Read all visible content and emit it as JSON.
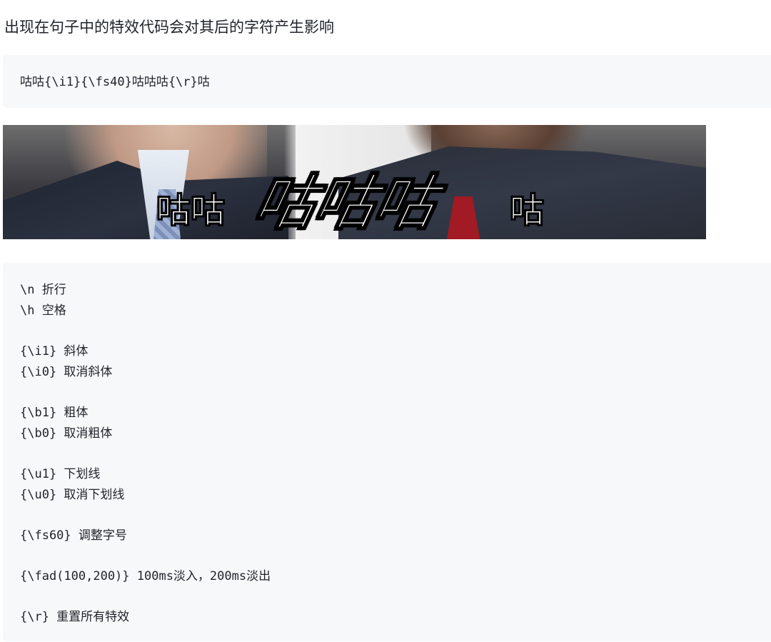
{
  "intro": "出现在句子中的特效代码会对其后的字符产生影响",
  "example_code": "咕咕{\\i1}{\\fs40}咕咕咕{\\r}咕",
  "preview": {
    "small_text": "咕咕",
    "big_text": "咕咕咕",
    "end_text": "咕"
  },
  "reference_groups": [
    [
      "\\n 折行",
      "\\h 空格"
    ],
    [
      "{\\i1} 斜体",
      "{\\i0} 取消斜体"
    ],
    [
      "{\\b1} 粗体",
      "{\\b0} 取消粗体"
    ],
    [
      "{\\u1} 下划线",
      "{\\u0} 取消下划线"
    ],
    [
      "{\\fs60} 调整字号"
    ],
    [
      "{\\fad(100,200)} 100ms淡入，200ms淡出"
    ],
    [
      "{\\r} 重置所有特效"
    ]
  ]
}
